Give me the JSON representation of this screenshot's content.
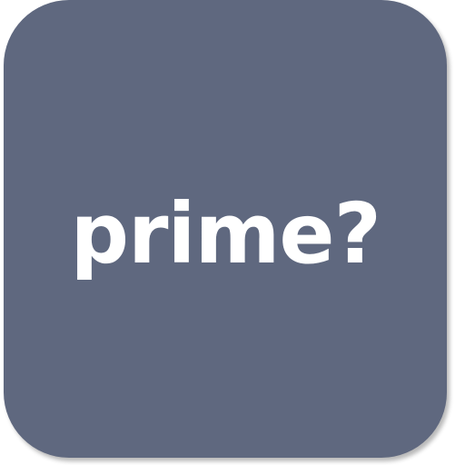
{
  "icon": {
    "label": "prime?",
    "background_color": "#5f687f",
    "text_color": "#ffffff"
  }
}
